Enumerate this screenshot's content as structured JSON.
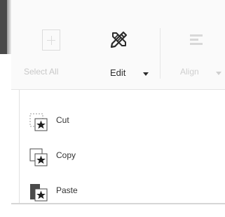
{
  "ribbon": {
    "select_all": {
      "label": "Select All",
      "icon": "select-all-icon",
      "enabled": false
    },
    "edit": {
      "label": "Edit",
      "icon": "edit-tools-icon",
      "enabled": true,
      "has_dropdown": true
    },
    "align": {
      "label": "Align",
      "icon": "align-icon",
      "enabled": false,
      "has_dropdown": true
    }
  },
  "edit_menu": {
    "items": [
      {
        "label": "Cut",
        "icon": "cut-icon"
      },
      {
        "label": "Copy",
        "icon": "copy-icon"
      },
      {
        "label": "Paste",
        "icon": "paste-icon"
      }
    ]
  },
  "colors": {
    "text": "#2b2b2b",
    "disabled_text": "#c8c8c8",
    "star": "#1f1f1f",
    "paste_board": "#4a4a4a"
  }
}
